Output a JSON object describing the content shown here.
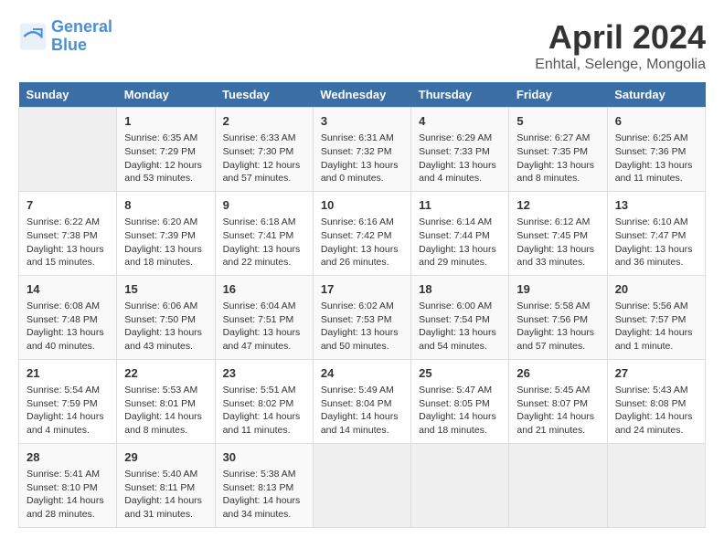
{
  "logo": {
    "line1": "General",
    "line2": "Blue"
  },
  "title": "April 2024",
  "subtitle": "Enhtal, Selenge, Mongolia",
  "days_of_week": [
    "Sunday",
    "Monday",
    "Tuesday",
    "Wednesday",
    "Thursday",
    "Friday",
    "Saturday"
  ],
  "weeks": [
    [
      {
        "day": "",
        "info": ""
      },
      {
        "day": "1",
        "info": "Sunrise: 6:35 AM\nSunset: 7:29 PM\nDaylight: 12 hours\nand 53 minutes."
      },
      {
        "day": "2",
        "info": "Sunrise: 6:33 AM\nSunset: 7:30 PM\nDaylight: 12 hours\nand 57 minutes."
      },
      {
        "day": "3",
        "info": "Sunrise: 6:31 AM\nSunset: 7:32 PM\nDaylight: 13 hours\nand 0 minutes."
      },
      {
        "day": "4",
        "info": "Sunrise: 6:29 AM\nSunset: 7:33 PM\nDaylight: 13 hours\nand 4 minutes."
      },
      {
        "day": "5",
        "info": "Sunrise: 6:27 AM\nSunset: 7:35 PM\nDaylight: 13 hours\nand 8 minutes."
      },
      {
        "day": "6",
        "info": "Sunrise: 6:25 AM\nSunset: 7:36 PM\nDaylight: 13 hours\nand 11 minutes."
      }
    ],
    [
      {
        "day": "7",
        "info": "Sunrise: 6:22 AM\nSunset: 7:38 PM\nDaylight: 13 hours\nand 15 minutes."
      },
      {
        "day": "8",
        "info": "Sunrise: 6:20 AM\nSunset: 7:39 PM\nDaylight: 13 hours\nand 18 minutes."
      },
      {
        "day": "9",
        "info": "Sunrise: 6:18 AM\nSunset: 7:41 PM\nDaylight: 13 hours\nand 22 minutes."
      },
      {
        "day": "10",
        "info": "Sunrise: 6:16 AM\nSunset: 7:42 PM\nDaylight: 13 hours\nand 26 minutes."
      },
      {
        "day": "11",
        "info": "Sunrise: 6:14 AM\nSunset: 7:44 PM\nDaylight: 13 hours\nand 29 minutes."
      },
      {
        "day": "12",
        "info": "Sunrise: 6:12 AM\nSunset: 7:45 PM\nDaylight: 13 hours\nand 33 minutes."
      },
      {
        "day": "13",
        "info": "Sunrise: 6:10 AM\nSunset: 7:47 PM\nDaylight: 13 hours\nand 36 minutes."
      }
    ],
    [
      {
        "day": "14",
        "info": "Sunrise: 6:08 AM\nSunset: 7:48 PM\nDaylight: 13 hours\nand 40 minutes."
      },
      {
        "day": "15",
        "info": "Sunrise: 6:06 AM\nSunset: 7:50 PM\nDaylight: 13 hours\nand 43 minutes."
      },
      {
        "day": "16",
        "info": "Sunrise: 6:04 AM\nSunset: 7:51 PM\nDaylight: 13 hours\nand 47 minutes."
      },
      {
        "day": "17",
        "info": "Sunrise: 6:02 AM\nSunset: 7:53 PM\nDaylight: 13 hours\nand 50 minutes."
      },
      {
        "day": "18",
        "info": "Sunrise: 6:00 AM\nSunset: 7:54 PM\nDaylight: 13 hours\nand 54 minutes."
      },
      {
        "day": "19",
        "info": "Sunrise: 5:58 AM\nSunset: 7:56 PM\nDaylight: 13 hours\nand 57 minutes."
      },
      {
        "day": "20",
        "info": "Sunrise: 5:56 AM\nSunset: 7:57 PM\nDaylight: 14 hours\nand 1 minute."
      }
    ],
    [
      {
        "day": "21",
        "info": "Sunrise: 5:54 AM\nSunset: 7:59 PM\nDaylight: 14 hours\nand 4 minutes."
      },
      {
        "day": "22",
        "info": "Sunrise: 5:53 AM\nSunset: 8:01 PM\nDaylight: 14 hours\nand 8 minutes."
      },
      {
        "day": "23",
        "info": "Sunrise: 5:51 AM\nSunset: 8:02 PM\nDaylight: 14 hours\nand 11 minutes."
      },
      {
        "day": "24",
        "info": "Sunrise: 5:49 AM\nSunset: 8:04 PM\nDaylight: 14 hours\nand 14 minutes."
      },
      {
        "day": "25",
        "info": "Sunrise: 5:47 AM\nSunset: 8:05 PM\nDaylight: 14 hours\nand 18 minutes."
      },
      {
        "day": "26",
        "info": "Sunrise: 5:45 AM\nSunset: 8:07 PM\nDaylight: 14 hours\nand 21 minutes."
      },
      {
        "day": "27",
        "info": "Sunrise: 5:43 AM\nSunset: 8:08 PM\nDaylight: 14 hours\nand 24 minutes."
      }
    ],
    [
      {
        "day": "28",
        "info": "Sunrise: 5:41 AM\nSunset: 8:10 PM\nDaylight: 14 hours\nand 28 minutes."
      },
      {
        "day": "29",
        "info": "Sunrise: 5:40 AM\nSunset: 8:11 PM\nDaylight: 14 hours\nand 31 minutes."
      },
      {
        "day": "30",
        "info": "Sunrise: 5:38 AM\nSunset: 8:13 PM\nDaylight: 14 hours\nand 34 minutes."
      },
      {
        "day": "",
        "info": ""
      },
      {
        "day": "",
        "info": ""
      },
      {
        "day": "",
        "info": ""
      },
      {
        "day": "",
        "info": ""
      }
    ]
  ]
}
